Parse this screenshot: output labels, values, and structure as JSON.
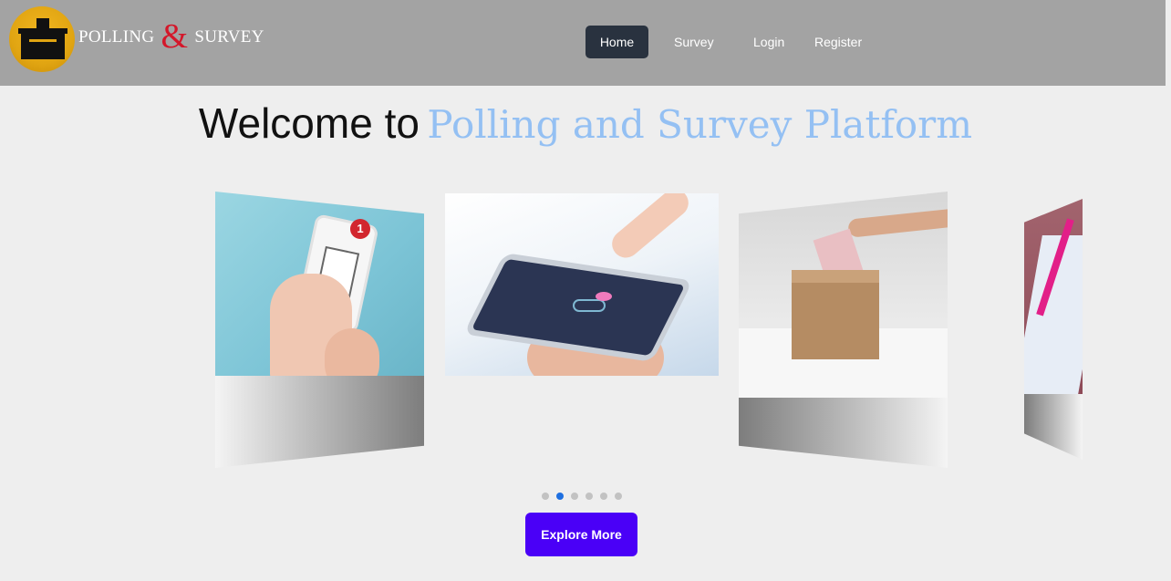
{
  "brand": {
    "name_left": "POLLING",
    "ampersand": "&",
    "name_right": "SURVEY",
    "icon": "ballot-box-icon"
  },
  "nav": {
    "home": "Home",
    "survey": "Survey",
    "login": "Login",
    "register": "Register",
    "active": "Home"
  },
  "hero": {
    "welcome": "Welcome to",
    "platform": "Polling and Survey Platform"
  },
  "carousel": {
    "slides": [
      {
        "name": "phone-checklist-image",
        "badge": "1"
      },
      {
        "name": "tablet-voting-image"
      },
      {
        "name": "ballot-box-image"
      },
      {
        "name": "pen-survey-form-image"
      }
    ],
    "dot_count": 6,
    "active_index": 1
  },
  "cta": {
    "explore": "Explore More"
  },
  "colors": {
    "accent": "#4a00f7",
    "header": "#a3a3a3",
    "nav_active": "#29323f",
    "title_highlight": "#94c0f3",
    "dot_active": "#1e6fe0",
    "dot_inactive": "#c2c2c2"
  }
}
